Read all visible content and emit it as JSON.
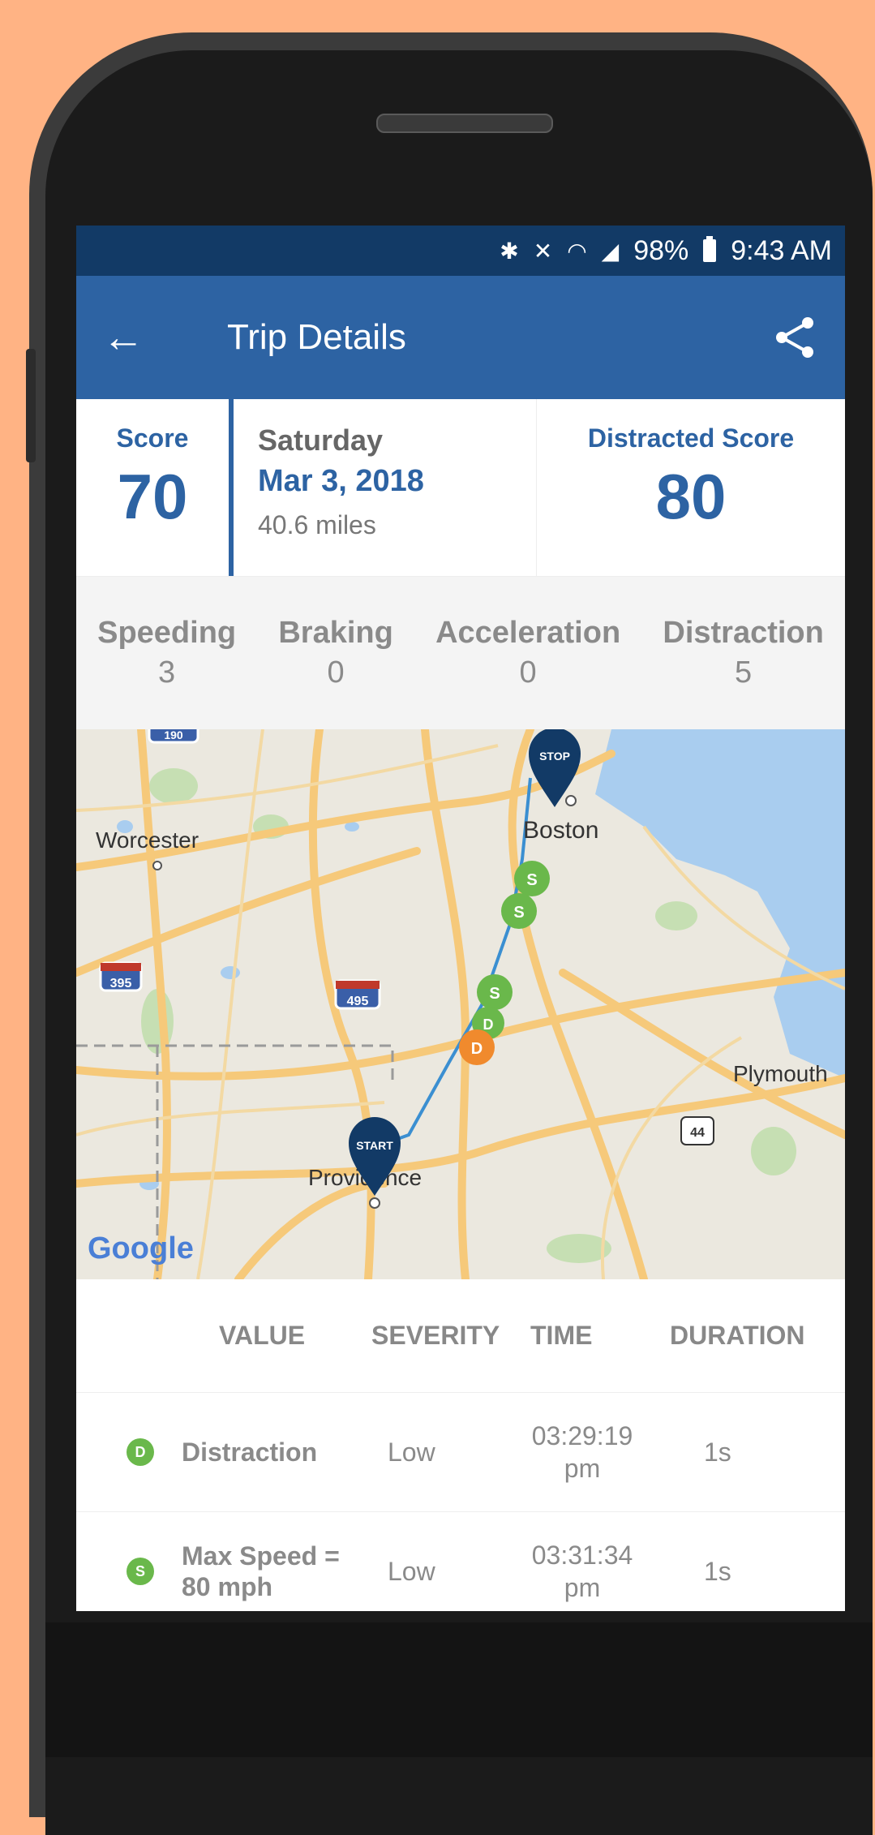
{
  "status_bar": {
    "battery": "98%",
    "time": "9:43 AM"
  },
  "app_bar": {
    "title": "Trip Details"
  },
  "summary": {
    "score_label": "Score",
    "score_value": "70",
    "day": "Saturday",
    "date": "Mar 3, 2018",
    "miles": "40.6 miles",
    "distracted_label": "Distracted Score",
    "distracted_value": "80"
  },
  "counts": [
    {
      "label": "Speeding",
      "value": "3"
    },
    {
      "label": "Braking",
      "value": "0"
    },
    {
      "label": "Acceleration",
      "value": "0"
    },
    {
      "label": "Distraction",
      "value": "5"
    }
  ],
  "map": {
    "places": [
      "Worcester",
      "Boston",
      "Plymouth",
      "Providence"
    ],
    "highways": [
      "395",
      "495",
      "44",
      "190"
    ],
    "start_label": "START",
    "stop_label": "STOP",
    "google": "Google"
  },
  "table": {
    "headers": [
      "VALUE",
      "SEVERITY",
      "TIME",
      "DURATION"
    ],
    "rows": [
      {
        "badge": "D",
        "value": "Distraction",
        "severity": "Low",
        "time": "03:29:19 pm",
        "duration": "1s"
      },
      {
        "badge": "S",
        "value": "Max Speed = 80 mph",
        "severity": "Low",
        "time": "03:31:34 pm",
        "duration": "1s"
      }
    ]
  },
  "colors": {
    "accent": "#2d63a3",
    "status_bar": "#123a66",
    "badge_green": "#6ab84b",
    "badge_orange": "#f08a2d",
    "background": "#ffb384"
  }
}
